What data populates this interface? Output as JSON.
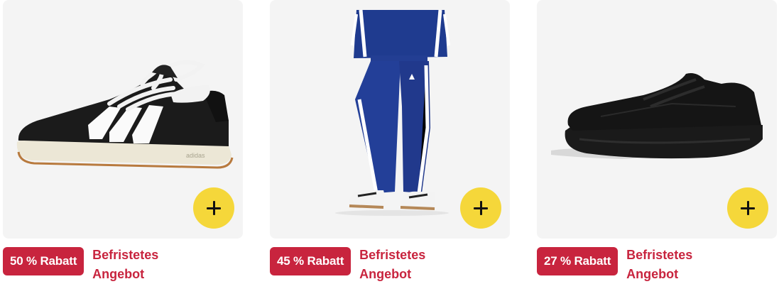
{
  "products": [
    {
      "image_subject": "black suede sneaker with white stripes",
      "discount_label": "50 % Rabatt",
      "offer_label": "Befristetes Angebot",
      "add_icon": "plus-icon"
    },
    {
      "image_subject": "navy track pants with white stripes",
      "discount_label": "45 % Rabatt",
      "offer_label": "Befristetes Angebot",
      "add_icon": "plus-icon"
    },
    {
      "image_subject": "all-black running shoe",
      "discount_label": "27 % Rabatt",
      "offer_label": "Befristetes Angebot",
      "add_icon": "plus-icon"
    }
  ],
  "colors": {
    "badge_background": "#c8243e",
    "offer_text": "#c8243e",
    "add_button": "#f5d73a",
    "card_background": "#f4f4f4"
  }
}
